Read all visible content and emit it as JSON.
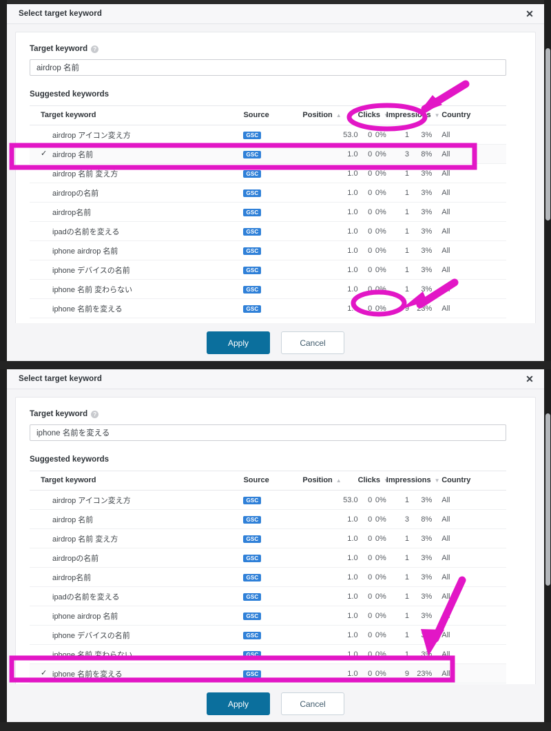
{
  "colors": {
    "annotation": "#E216C6",
    "accent_button": "#0B6F9D",
    "badge": "#2F80D8"
  },
  "dialogs": [
    {
      "title": "Select target keyword",
      "close_label": "✕",
      "field_label": "Target keyword",
      "help_icon": "?",
      "input_value": "airdrop 名前",
      "input_placeholder": "Target keyword",
      "section_label": "Suggested keywords",
      "columns": {
        "keyword": "Target keyword",
        "source": "Source",
        "position": "Position",
        "clicks": "Clicks",
        "impressions": "Impressions",
        "country": "Country"
      },
      "sort": {
        "position": "▲",
        "clicks": "▼",
        "impressions": "▼"
      },
      "rows": [
        {
          "checked": false,
          "keyword": "airdrop アイコン変え方",
          "source": "GSC",
          "position": "53.0",
          "clicks": "0",
          "ctr": "0%",
          "impressions": "1",
          "impr_pct": "3%",
          "country": "All"
        },
        {
          "checked": true,
          "keyword": "airdrop 名前",
          "source": "GSC",
          "position": "1.0",
          "clicks": "0",
          "ctr": "0%",
          "impressions": "3",
          "impr_pct": "8%",
          "country": "All"
        },
        {
          "checked": false,
          "keyword": "airdrop 名前 変え方",
          "source": "GSC",
          "position": "1.0",
          "clicks": "0",
          "ctr": "0%",
          "impressions": "1",
          "impr_pct": "3%",
          "country": "All"
        },
        {
          "checked": false,
          "keyword": "airdropの名前",
          "source": "GSC",
          "position": "1.0",
          "clicks": "0",
          "ctr": "0%",
          "impressions": "1",
          "impr_pct": "3%",
          "country": "All"
        },
        {
          "checked": false,
          "keyword": "airdrop名前",
          "source": "GSC",
          "position": "1.0",
          "clicks": "0",
          "ctr": "0%",
          "impressions": "1",
          "impr_pct": "3%",
          "country": "All"
        },
        {
          "checked": false,
          "keyword": "ipadの名前を変える",
          "source": "GSC",
          "position": "1.0",
          "clicks": "0",
          "ctr": "0%",
          "impressions": "1",
          "impr_pct": "3%",
          "country": "All"
        },
        {
          "checked": false,
          "keyword": "iphone airdrop 名前",
          "source": "GSC",
          "position": "1.0",
          "clicks": "0",
          "ctr": "0%",
          "impressions": "1",
          "impr_pct": "3%",
          "country": "All"
        },
        {
          "checked": false,
          "keyword": "iphone デバイスの名前",
          "source": "GSC",
          "position": "1.0",
          "clicks": "0",
          "ctr": "0%",
          "impressions": "1",
          "impr_pct": "3%",
          "country": "All"
        },
        {
          "checked": false,
          "keyword": "iphone 名前 変わらない",
          "source": "GSC",
          "position": "1.0",
          "clicks": "0",
          "ctr": "0%",
          "impressions": "1",
          "impr_pct": "3%",
          "country": "All"
        },
        {
          "checked": false,
          "keyword": "iphone 名前を変える",
          "source": "GSC",
          "position": "1.0",
          "clicks": "0",
          "ctr": "0%",
          "impressions": "9",
          "impr_pct": "23%",
          "country": "All"
        }
      ],
      "apply_label": "Apply",
      "cancel_label": "Cancel"
    },
    {
      "title": "Select target keyword",
      "close_label": "✕",
      "field_label": "Target keyword",
      "help_icon": "?",
      "input_value": "iphone 名前を変える",
      "input_placeholder": "Target keyword",
      "section_label": "Suggested keywords",
      "columns": {
        "keyword": "Target keyword",
        "source": "Source",
        "position": "Position",
        "clicks": "Clicks",
        "impressions": "Impressions",
        "country": "Country"
      },
      "sort": {
        "position": "▲",
        "clicks": "▼",
        "impressions": "▼"
      },
      "rows": [
        {
          "checked": false,
          "keyword": "airdrop アイコン変え方",
          "source": "GSC",
          "position": "53.0",
          "clicks": "0",
          "ctr": "0%",
          "impressions": "1",
          "impr_pct": "3%",
          "country": "All"
        },
        {
          "checked": false,
          "keyword": "airdrop 名前",
          "source": "GSC",
          "position": "1.0",
          "clicks": "0",
          "ctr": "0%",
          "impressions": "3",
          "impr_pct": "8%",
          "country": "All"
        },
        {
          "checked": false,
          "keyword": "airdrop 名前 変え方",
          "source": "GSC",
          "position": "1.0",
          "clicks": "0",
          "ctr": "0%",
          "impressions": "1",
          "impr_pct": "3%",
          "country": "All"
        },
        {
          "checked": false,
          "keyword": "airdropの名前",
          "source": "GSC",
          "position": "1.0",
          "clicks": "0",
          "ctr": "0%",
          "impressions": "1",
          "impr_pct": "3%",
          "country": "All"
        },
        {
          "checked": false,
          "keyword": "airdrop名前",
          "source": "GSC",
          "position": "1.0",
          "clicks": "0",
          "ctr": "0%",
          "impressions": "1",
          "impr_pct": "3%",
          "country": "All"
        },
        {
          "checked": false,
          "keyword": "ipadの名前を変える",
          "source": "GSC",
          "position": "1.0",
          "clicks": "0",
          "ctr": "0%",
          "impressions": "1",
          "impr_pct": "3%",
          "country": "All"
        },
        {
          "checked": false,
          "keyword": "iphone airdrop 名前",
          "source": "GSC",
          "position": "1.0",
          "clicks": "0",
          "ctr": "0%",
          "impressions": "1",
          "impr_pct": "3%",
          "country": "All"
        },
        {
          "checked": false,
          "keyword": "iphone デバイスの名前",
          "source": "GSC",
          "position": "1.0",
          "clicks": "0",
          "ctr": "0%",
          "impressions": "1",
          "impr_pct": "3%",
          "country": "All"
        },
        {
          "checked": false,
          "keyword": "iphone 名前 変わらない",
          "source": "GSC",
          "position": "1.0",
          "clicks": "0",
          "ctr": "0%",
          "impressions": "1",
          "impr_pct": "3%",
          "country": "All"
        },
        {
          "checked": true,
          "keyword": "iphone 名前を変える",
          "source": "GSC",
          "position": "1.0",
          "clicks": "0",
          "ctr": "0%",
          "impressions": "9",
          "impr_pct": "23%",
          "country": "All"
        }
      ],
      "apply_label": "Apply",
      "cancel_label": "Cancel"
    }
  ]
}
